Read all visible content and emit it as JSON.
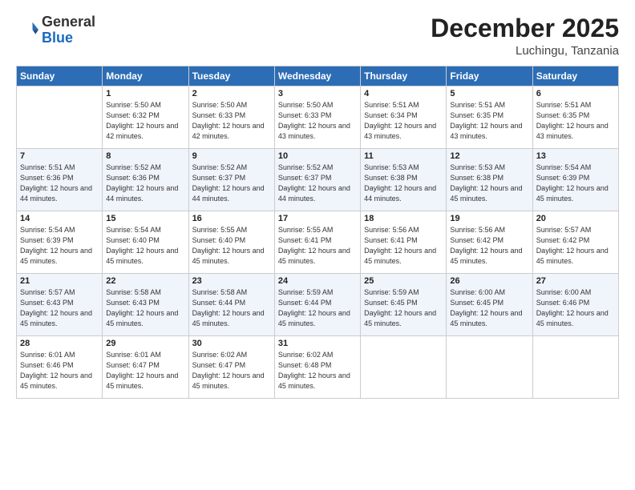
{
  "header": {
    "logo_general": "General",
    "logo_blue": "Blue",
    "month_year": "December 2025",
    "location": "Luchingu, Tanzania"
  },
  "days_of_week": [
    "Sunday",
    "Monday",
    "Tuesday",
    "Wednesday",
    "Thursday",
    "Friday",
    "Saturday"
  ],
  "weeks": [
    [
      {
        "day": "",
        "info": ""
      },
      {
        "day": "1",
        "info": "Sunrise: 5:50 AM\nSunset: 6:32 PM\nDaylight: 12 hours\nand 42 minutes."
      },
      {
        "day": "2",
        "info": "Sunrise: 5:50 AM\nSunset: 6:33 PM\nDaylight: 12 hours\nand 42 minutes."
      },
      {
        "day": "3",
        "info": "Sunrise: 5:50 AM\nSunset: 6:33 PM\nDaylight: 12 hours\nand 43 minutes."
      },
      {
        "day": "4",
        "info": "Sunrise: 5:51 AM\nSunset: 6:34 PM\nDaylight: 12 hours\nand 43 minutes."
      },
      {
        "day": "5",
        "info": "Sunrise: 5:51 AM\nSunset: 6:35 PM\nDaylight: 12 hours\nand 43 minutes."
      },
      {
        "day": "6",
        "info": "Sunrise: 5:51 AM\nSunset: 6:35 PM\nDaylight: 12 hours\nand 43 minutes."
      }
    ],
    [
      {
        "day": "7",
        "info": "Sunrise: 5:51 AM\nSunset: 6:36 PM\nDaylight: 12 hours\nand 44 minutes."
      },
      {
        "day": "8",
        "info": "Sunrise: 5:52 AM\nSunset: 6:36 PM\nDaylight: 12 hours\nand 44 minutes."
      },
      {
        "day": "9",
        "info": "Sunrise: 5:52 AM\nSunset: 6:37 PM\nDaylight: 12 hours\nand 44 minutes."
      },
      {
        "day": "10",
        "info": "Sunrise: 5:52 AM\nSunset: 6:37 PM\nDaylight: 12 hours\nand 44 minutes."
      },
      {
        "day": "11",
        "info": "Sunrise: 5:53 AM\nSunset: 6:38 PM\nDaylight: 12 hours\nand 44 minutes."
      },
      {
        "day": "12",
        "info": "Sunrise: 5:53 AM\nSunset: 6:38 PM\nDaylight: 12 hours\nand 45 minutes."
      },
      {
        "day": "13",
        "info": "Sunrise: 5:54 AM\nSunset: 6:39 PM\nDaylight: 12 hours\nand 45 minutes."
      }
    ],
    [
      {
        "day": "14",
        "info": "Sunrise: 5:54 AM\nSunset: 6:39 PM\nDaylight: 12 hours\nand 45 minutes."
      },
      {
        "day": "15",
        "info": "Sunrise: 5:54 AM\nSunset: 6:40 PM\nDaylight: 12 hours\nand 45 minutes."
      },
      {
        "day": "16",
        "info": "Sunrise: 5:55 AM\nSunset: 6:40 PM\nDaylight: 12 hours\nand 45 minutes."
      },
      {
        "day": "17",
        "info": "Sunrise: 5:55 AM\nSunset: 6:41 PM\nDaylight: 12 hours\nand 45 minutes."
      },
      {
        "day": "18",
        "info": "Sunrise: 5:56 AM\nSunset: 6:41 PM\nDaylight: 12 hours\nand 45 minutes."
      },
      {
        "day": "19",
        "info": "Sunrise: 5:56 AM\nSunset: 6:42 PM\nDaylight: 12 hours\nand 45 minutes."
      },
      {
        "day": "20",
        "info": "Sunrise: 5:57 AM\nSunset: 6:42 PM\nDaylight: 12 hours\nand 45 minutes."
      }
    ],
    [
      {
        "day": "21",
        "info": "Sunrise: 5:57 AM\nSunset: 6:43 PM\nDaylight: 12 hours\nand 45 minutes."
      },
      {
        "day": "22",
        "info": "Sunrise: 5:58 AM\nSunset: 6:43 PM\nDaylight: 12 hours\nand 45 minutes."
      },
      {
        "day": "23",
        "info": "Sunrise: 5:58 AM\nSunset: 6:44 PM\nDaylight: 12 hours\nand 45 minutes."
      },
      {
        "day": "24",
        "info": "Sunrise: 5:59 AM\nSunset: 6:44 PM\nDaylight: 12 hours\nand 45 minutes."
      },
      {
        "day": "25",
        "info": "Sunrise: 5:59 AM\nSunset: 6:45 PM\nDaylight: 12 hours\nand 45 minutes."
      },
      {
        "day": "26",
        "info": "Sunrise: 6:00 AM\nSunset: 6:45 PM\nDaylight: 12 hours\nand 45 minutes."
      },
      {
        "day": "27",
        "info": "Sunrise: 6:00 AM\nSunset: 6:46 PM\nDaylight: 12 hours\nand 45 minutes."
      }
    ],
    [
      {
        "day": "28",
        "info": "Sunrise: 6:01 AM\nSunset: 6:46 PM\nDaylight: 12 hours\nand 45 minutes."
      },
      {
        "day": "29",
        "info": "Sunrise: 6:01 AM\nSunset: 6:47 PM\nDaylight: 12 hours\nand 45 minutes."
      },
      {
        "day": "30",
        "info": "Sunrise: 6:02 AM\nSunset: 6:47 PM\nDaylight: 12 hours\nand 45 minutes."
      },
      {
        "day": "31",
        "info": "Sunrise: 6:02 AM\nSunset: 6:48 PM\nDaylight: 12 hours\nand 45 minutes."
      },
      {
        "day": "",
        "info": ""
      },
      {
        "day": "",
        "info": ""
      },
      {
        "day": "",
        "info": ""
      }
    ]
  ]
}
